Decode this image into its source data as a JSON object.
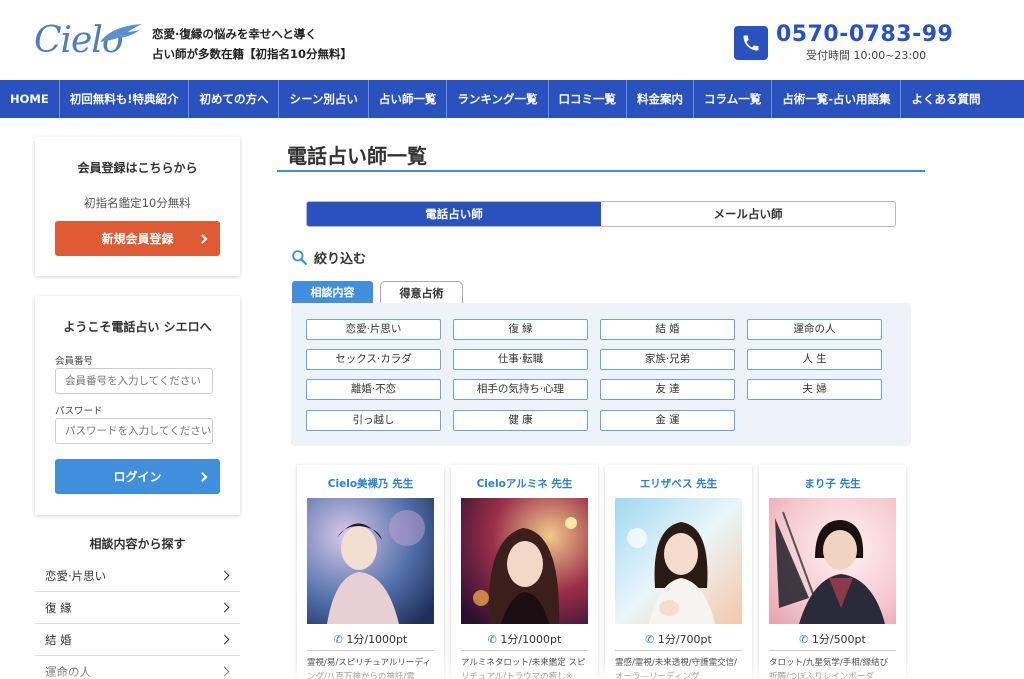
{
  "header": {
    "logo_text": "Cielo",
    "tagline_line1": "恋愛·復縁の悩みを幸せへと導く",
    "tagline_line2": "占い師が多数在籍【初指名10分無料】",
    "phone_number": "0570-0783-99",
    "phone_hours": "受付時間 10:00~23:00"
  },
  "nav": {
    "items": [
      "HOME",
      "初回無料も!特典紹介",
      "初めての方へ",
      "シーン別占い",
      "占い師一覧",
      "ランキング一覧",
      "口コミ一覧",
      "料金案内",
      "コラム一覧",
      "占術一覧-占い用語集",
      "よくある質問"
    ]
  },
  "sidebar": {
    "register": {
      "title": "会員登録はこちらから",
      "subtitle": "初指名鑑定10分無料",
      "button": "新規会員登録"
    },
    "login": {
      "title": "ようこそ電話占い シエロへ",
      "member_label": "会員番号",
      "member_placeholder": "会員番号を入力してください",
      "password_label": "パスワード",
      "password_placeholder": "パスワードを入力してください",
      "button": "ログイン"
    },
    "categories": {
      "title": "相談内容から探す",
      "items": [
        "恋愛·片思い",
        "復 縁",
        "結 婚",
        "運命の人"
      ]
    }
  },
  "main": {
    "title": "電話占い師一覧",
    "toggle": {
      "phone": "電話占い師",
      "mail": "メール占い師"
    },
    "filter": {
      "title": "絞り込む",
      "tabs": [
        "相談内容",
        "得意占術"
      ],
      "tags": [
        "恋愛·片思い",
        "復 縁",
        "結 婚",
        "運命の人",
        "セックス·カラダ",
        "仕事·転職",
        "家族·兄弟",
        "人 生",
        "離婚·不恋",
        "相手の気持ち·心理",
        "友 達",
        "夫 婦",
        "引っ越し",
        "健 康",
        "金 運"
      ]
    },
    "fortune_tellers": [
      {
        "name": "Cielo美裸乃 先生",
        "price": "1分/1000pt",
        "desc": "霊視/易/スピリチュアルリーディング/八百万神からの神託/霊"
      },
      {
        "name": "Cieloアルミネ 先生",
        "price": "1分/1000pt",
        "desc": "アルミネタロット/未来鑑定 スピリチュアル/トラウマの癒し※"
      },
      {
        "name": "エリザベス 先生",
        "price": "1分/700pt",
        "desc": "霊感/霊視/未来透視/守護霊交信/オーラ―リーディング"
      },
      {
        "name": "まり子 先生",
        "price": "1分/500pt",
        "desc": "タロット/九星気学/手相/縁結び祈願/つぼふりレインボーダ"
      }
    ]
  },
  "colors": {
    "brand_blue": "#2a52be",
    "accent_blue": "#3f8fdc",
    "register_orange": "#e05a33"
  }
}
